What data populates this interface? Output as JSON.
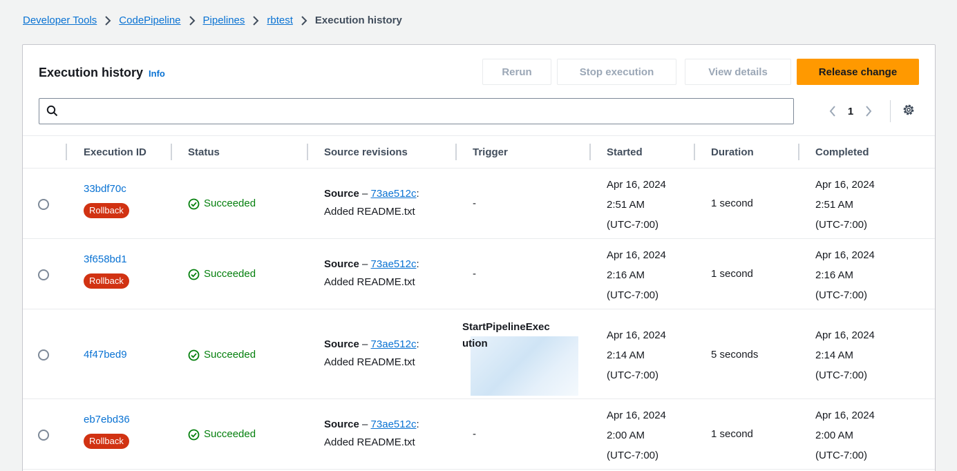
{
  "breadcrumb": {
    "items": [
      "Developer Tools",
      "CodePipeline",
      "Pipelines",
      "rbtest"
    ],
    "current": "Execution history"
  },
  "panel": {
    "title": "Execution history",
    "info_label": "Info"
  },
  "actions": {
    "rerun": "Rerun",
    "stop": "Stop execution",
    "view_details": "View details",
    "release": "Release change"
  },
  "search": {
    "placeholder": "",
    "value": ""
  },
  "pagination": {
    "current_page": "1"
  },
  "columns": [
    "Execution ID",
    "Status",
    "Source revisions",
    "Trigger",
    "Started",
    "Duration",
    "Completed"
  ],
  "rows": [
    {
      "id": "33bdf70c",
      "badge": "Rollback",
      "status": "Succeeded",
      "source_label": "Source",
      "source_dash": " – ",
      "source_commit": "73ae512c",
      "source_colon": ":",
      "source_message": "Added README.txt",
      "trigger_line1": "-",
      "trigger_line2": "",
      "started": [
        "Apr 16, 2024",
        "2:51 AM",
        "(UTC-7:00)"
      ],
      "duration": "1 second",
      "completed": [
        "Apr 16, 2024",
        "2:51 AM",
        "(UTC-7:00)"
      ]
    },
    {
      "id": "3f658bd1",
      "badge": "Rollback",
      "status": "Succeeded",
      "source_label": "Source",
      "source_dash": " – ",
      "source_commit": "73ae512c",
      "source_colon": ":",
      "source_message": "Added README.txt",
      "trigger_line1": "-",
      "trigger_line2": "",
      "started": [
        "Apr 16, 2024",
        "2:16 AM",
        "(UTC-7:00)"
      ],
      "duration": "1 second",
      "completed": [
        "Apr 16, 2024",
        "2:16 AM",
        "(UTC-7:00)"
      ]
    },
    {
      "id": "4f47bed9",
      "badge": "",
      "status": "Succeeded",
      "source_label": "Source",
      "source_dash": " – ",
      "source_commit": "73ae512c",
      "source_colon": ":",
      "source_message": "Added README.txt",
      "trigger_line1": "StartPipelineExec",
      "trigger_line2": "ution",
      "started": [
        "Apr 16, 2024",
        "2:14 AM",
        "(UTC-7:00)"
      ],
      "duration": "5 seconds",
      "completed": [
        "Apr 16, 2024",
        "2:14 AM",
        "(UTC-7:00)"
      ]
    },
    {
      "id": "eb7ebd36",
      "badge": "Rollback",
      "status": "Succeeded",
      "source_label": "Source",
      "source_dash": " – ",
      "source_commit": "73ae512c",
      "source_colon": ":",
      "source_message": "Added README.txt",
      "trigger_line1": "-",
      "trigger_line2": "",
      "started": [
        "Apr 16, 2024",
        "2:00 AM",
        "(UTC-7:00)"
      ],
      "duration": "1 second",
      "completed": [
        "Apr 16, 2024",
        "2:00 AM",
        "(UTC-7:00)"
      ]
    }
  ]
}
